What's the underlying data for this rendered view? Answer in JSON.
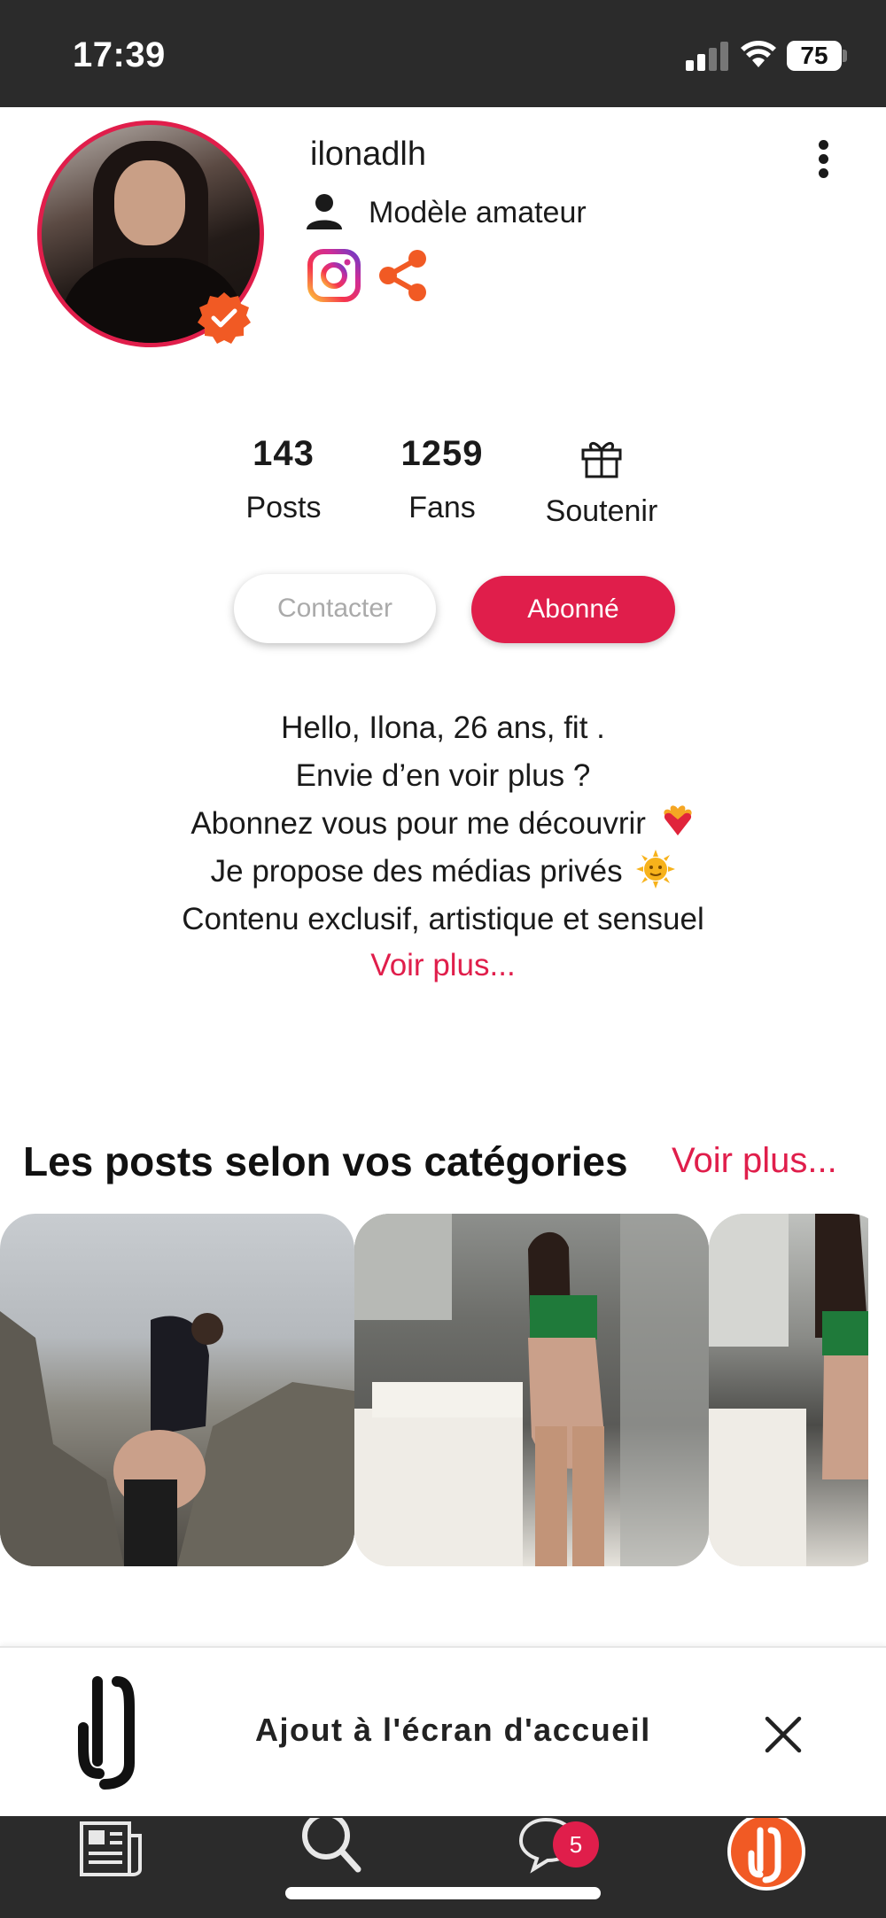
{
  "status_bar": {
    "time": "17:39",
    "battery": "75"
  },
  "profile": {
    "username": "ilonadlh",
    "type": "Modèle amateur"
  },
  "stats": {
    "posts_value": "143",
    "posts_label": "Posts",
    "fans_value": "1259",
    "fans_label": "Fans",
    "support_label": "Soutenir"
  },
  "actions": {
    "contact_label": "Contacter",
    "subscribed_label": "Abonné"
  },
  "bio": {
    "line1": "Hello, Ilona, 26 ans, fit .",
    "line2": "Envie d’en voir plus ?",
    "line3": "Abonnez vous  pour me découvrir",
    "line4": "Je propose des médias privés",
    "line5": "Contenu exclusif, artistique et sensuel",
    "more": "Voir plus..."
  },
  "categories": {
    "title": "Les posts selon vos catégories",
    "more": "Voir plus..."
  },
  "add_to_home": {
    "text": "Ajout à l'écran d'accueil"
  },
  "bottom_nav": {
    "messages_badge": "5"
  },
  "colors": {
    "accent": "#e01e4b",
    "bar": "#2b2b2b",
    "share": "#f15a24"
  },
  "icons": [
    "verified-icon",
    "more-vertical-icon",
    "person-icon",
    "instagram-icon",
    "share-icon",
    "gift-icon",
    "close-icon",
    "news-icon",
    "search-icon",
    "chat-icon",
    "profile-logo-icon"
  ]
}
